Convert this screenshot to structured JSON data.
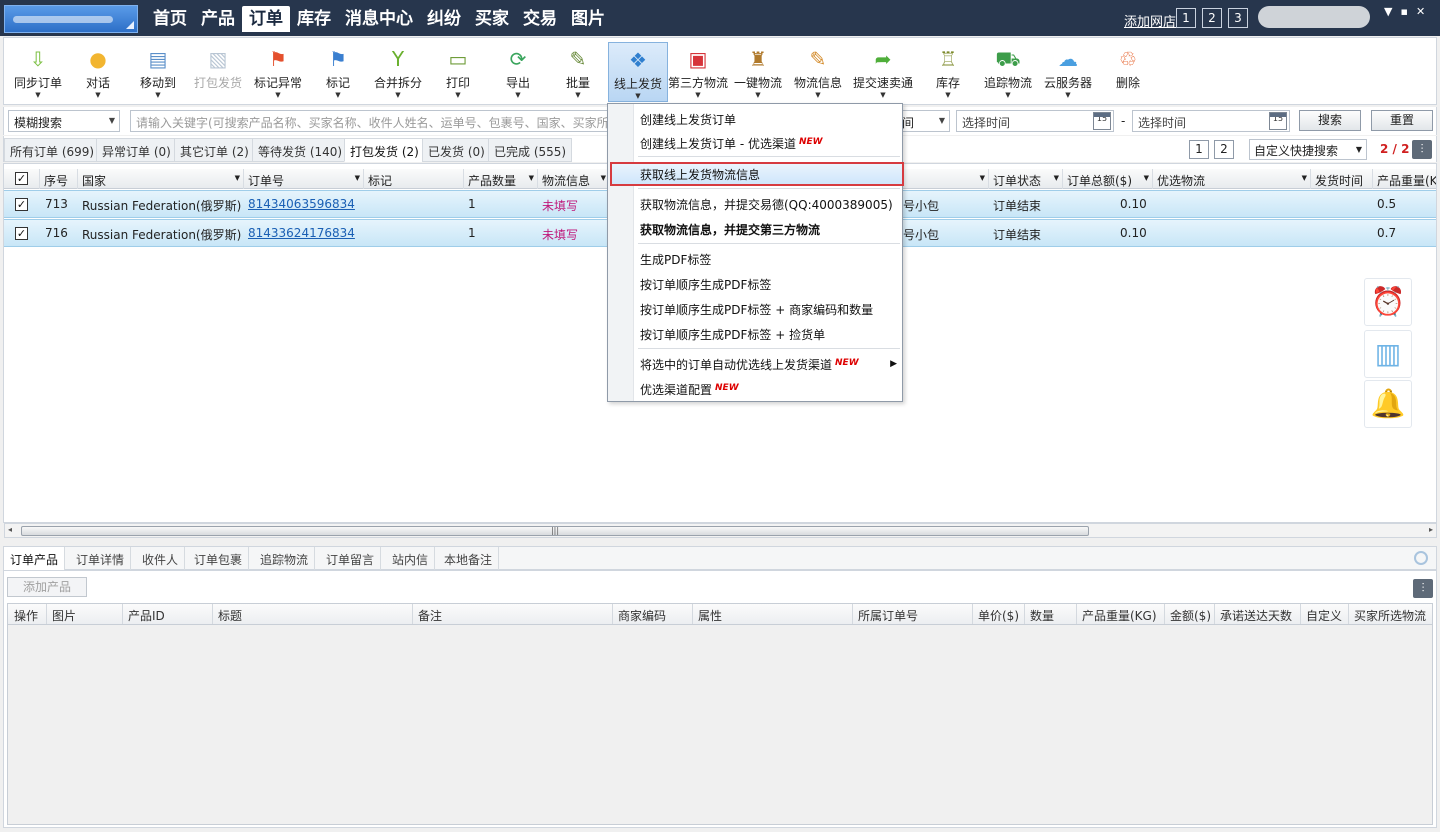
{
  "nav": {
    "items": [
      "首页",
      "产品",
      "订单",
      "库存",
      "消息中心",
      "纠纷",
      "买家",
      "交易",
      "图片"
    ],
    "active_index": 2,
    "add_store": "添加网店",
    "store_nums": [
      "1",
      "2",
      "3"
    ],
    "win_buttons": [
      "▼",
      "▪",
      "✕"
    ]
  },
  "toolbar": {
    "buttons": [
      {
        "label": "同步订单",
        "icon": "download-arrow-icon",
        "glyph": "⇩",
        "color": "#7cc043",
        "caret": true
      },
      {
        "label": "对话",
        "icon": "chat-users-icon",
        "glyph": "●",
        "color": "#f2b530",
        "caret": true
      },
      {
        "label": "移动到",
        "icon": "move-folder-icon",
        "glyph": "▤",
        "color": "#5b8fc9",
        "caret": true
      },
      {
        "label": "打包发货",
        "icon": "package-ship-icon",
        "glyph": "▧",
        "color": "#b9c6d4",
        "caret": false,
        "disabled": true
      },
      {
        "label": "标记异常",
        "icon": "red-flag-icon",
        "glyph": "⚑",
        "color": "#e4502d",
        "caret": true
      },
      {
        "label": "标记",
        "icon": "blue-flag-icon",
        "glyph": "⚑",
        "color": "#3a7fd0",
        "caret": true
      },
      {
        "label": "合并拆分",
        "icon": "merge-split-icon",
        "glyph": "Y",
        "color": "#6ab02e",
        "caret": true
      },
      {
        "label": "打印",
        "icon": "printer-icon",
        "glyph": "▭",
        "color": "#6f9d3a",
        "caret": true
      },
      {
        "label": "导出",
        "icon": "export-icon",
        "glyph": "⟳",
        "color": "#3aa55d",
        "caret": true
      },
      {
        "label": "批量",
        "icon": "batch-edit-icon",
        "glyph": "✎",
        "color": "#6a8b3c",
        "caret": true
      },
      {
        "label": "线上发货",
        "icon": "online-ship-icon",
        "glyph": "❖",
        "color": "#2f7fcf",
        "caret": true,
        "active": true
      },
      {
        "label": "第三方物流",
        "icon": "third-party-logistics-icon",
        "glyph": "▣",
        "color": "#d6343a",
        "caret": true
      },
      {
        "label": "一键物流",
        "icon": "one-click-logistics-icon",
        "glyph": "♜",
        "color": "#b07a2c",
        "caret": true
      },
      {
        "label": "物流信息",
        "icon": "logistics-info-pencil-icon",
        "glyph": "✎",
        "color": "#d48b2a",
        "caret": true
      },
      {
        "label": "提交速卖通",
        "icon": "submit-arrow-icon",
        "glyph": "➦",
        "color": "#4fae3a",
        "caret": true
      },
      {
        "label": "库存",
        "icon": "forklift-icon",
        "glyph": "♖",
        "color": "#7c8a2a",
        "caret": true
      },
      {
        "label": "追踪物流",
        "icon": "tracking-truck-icon",
        "glyph": "⛟",
        "color": "#3d9d4a",
        "caret": true
      },
      {
        "label": "云服务器",
        "icon": "cloud-server-icon",
        "glyph": "☁",
        "color": "#4a9fe0",
        "caret": true
      },
      {
        "label": "删除",
        "icon": "trash-icon",
        "glyph": "♲",
        "color": "#e6602a",
        "caret": false
      }
    ]
  },
  "search": {
    "mode": "模糊搜索",
    "keyword_placeholder": "请输入关键字(可搜索产品名称、买家名称、收件人姓名、运单号、包裹号、国家、买家所",
    "time_type": "时间",
    "date_from": "选择时间",
    "date_to": "选择时间",
    "dash": "-",
    "calendar_day": "15",
    "search_btn": "搜索",
    "reset_btn": "重置"
  },
  "order_tabs": [
    {
      "label": "所有订单 (699)"
    },
    {
      "label": "异常订单 (0)"
    },
    {
      "label": "其它订单 (2)"
    },
    {
      "label": "等待发货 (140)"
    },
    {
      "label": "打包发货 (2)",
      "active": true
    },
    {
      "label": "已发货 (0)"
    },
    {
      "label": "已完成 (555)"
    }
  ],
  "pagination": {
    "pages": [
      "1",
      "2"
    ],
    "quick_search": "自定义快捷搜索",
    "page_count": "2 / 2"
  },
  "grid": {
    "columns": [
      "序号",
      "国家",
      "订单号",
      "标记",
      "产品数量",
      "物流信息",
      "订单状态",
      "订单总额($)",
      "优选物流",
      "发货时间",
      "产品重量(K"
    ],
    "rows": [
      {
        "seq": "713",
        "country": "Russian Federation(俄罗斯)",
        "order_no": "81434063596834",
        "qty": "1",
        "logistics": "未填写",
        "ship_tail": "号小包",
        "status": "订单结束",
        "total": "0.10",
        "weight": "0.5"
      },
      {
        "seq": "716",
        "country": "Russian Federation(俄罗斯)",
        "order_no": "81433624176834",
        "qty": "1",
        "logistics": "未填写",
        "ship_tail": "号小包",
        "status": "订单结束",
        "total": "0.10",
        "weight": "0.7"
      }
    ]
  },
  "scrollbar": {
    "grip": "|||",
    "left": "◂",
    "right": "▸"
  },
  "bottom": {
    "tabs": [
      "订单产品",
      "订单详情",
      "收件人",
      "订单包裹",
      "追踪物流",
      "订单留言",
      "站内信",
      "本地备注"
    ],
    "add_product": "添加产品",
    "columns": [
      "操作",
      "图片",
      "产品ID",
      "标题",
      "备注",
      "商家编码",
      "属性",
      "所属订单号",
      "单价($)",
      "数量",
      "产品重量(KG)",
      "金额($)",
      "承诺送达天数",
      "自定义",
      "买家所选物流"
    ]
  },
  "menu": {
    "items": [
      {
        "label": "创建线上发货订单"
      },
      {
        "label": "创建线上发货订单 - 优选渠道",
        "new": "NEW"
      },
      {
        "label": "获取线上发货物流信息",
        "highlight": true
      },
      {
        "label": "获取物流信息，并提交易德(QQ:4000389005)"
      },
      {
        "label": "获取物流信息，并提交第三方物流",
        "bold": true
      },
      {
        "label": "生成PDF标签"
      },
      {
        "label": "按订单顺序生成PDF标签"
      },
      {
        "label": "按订单顺序生成PDF标签 + 商家编码和数量"
      },
      {
        "label": "按订单顺序生成PDF标签 + 捡货单"
      },
      {
        "label": "将选中的订单自动优选线上发货渠道",
        "new": "NEW",
        "submenu": true
      },
      {
        "label": "优选渠道配置",
        "new": "NEW"
      }
    ]
  },
  "colors": {
    "topbar": "#27364d",
    "accent": "#2f7fcf",
    "highlight_border": "#d63b40",
    "pink": "#c0187a"
  }
}
